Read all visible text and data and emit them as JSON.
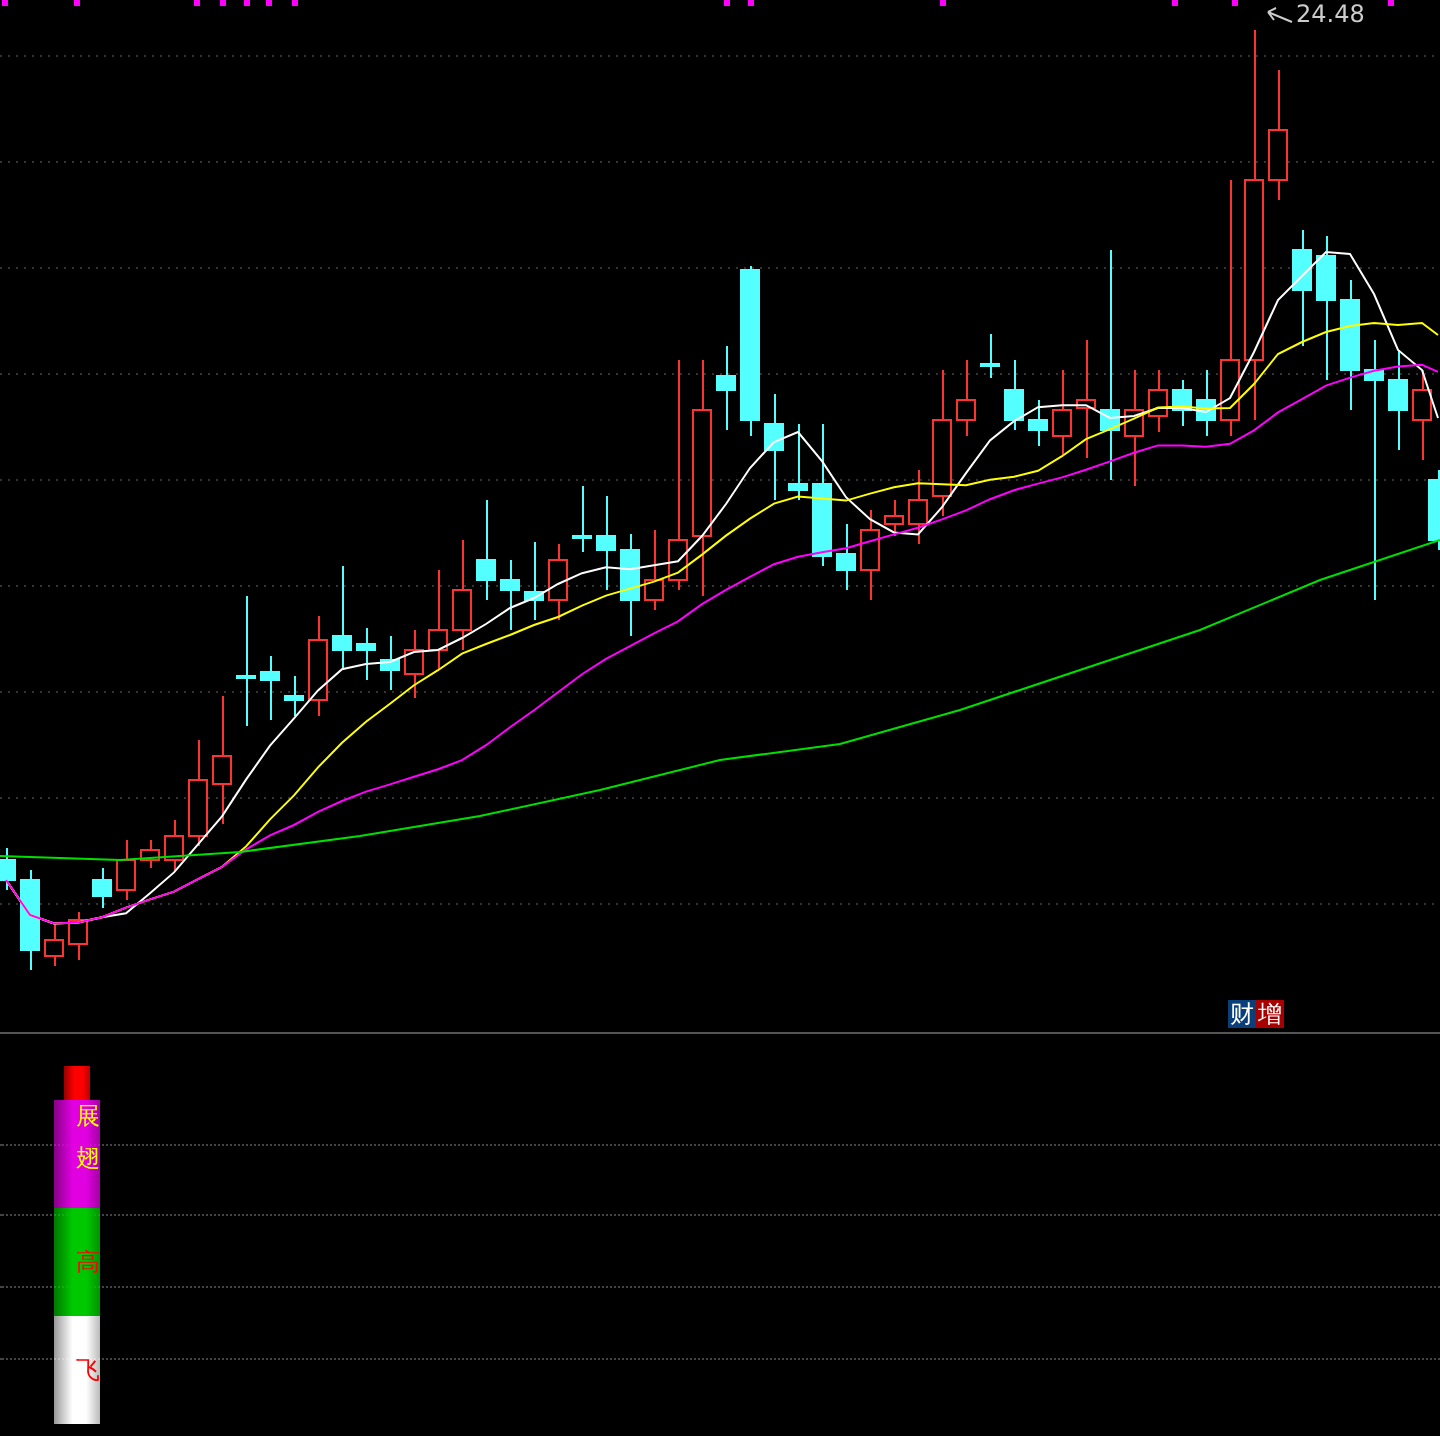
{
  "main_chart": {
    "high_label": "24.48",
    "badges": [
      {
        "text": "财",
        "color": "#0b3f7a"
      },
      {
        "text": "增",
        "color": "#a80000"
      }
    ]
  },
  "indicator_panel": {
    "segments": [
      {
        "color": "#ff0000"
      },
      {
        "color": "#e000e0",
        "labels": [
          {
            "text": "展",
            "color": "#ffff00"
          },
          {
            "text": "翅",
            "color": "#ffff00"
          }
        ]
      },
      {
        "color": "#00c800",
        "labels": [
          {
            "text": "高",
            "color": "#ff0000"
          }
        ]
      },
      {
        "color": "#ffffff",
        "labels": [
          {
            "text": "飞",
            "color": "#ff0000"
          }
        ]
      }
    ]
  }
}
